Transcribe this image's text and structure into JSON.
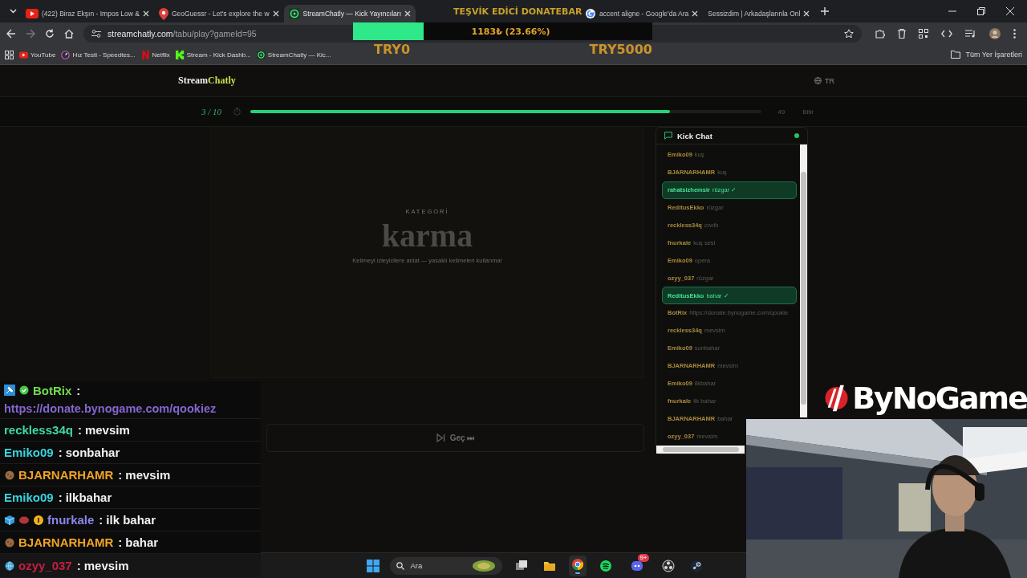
{
  "browser": {
    "tabs": [
      {
        "title": "(422) Biraz Ekşın - Impos Low &",
        "kind": "youtube",
        "selected": false
      },
      {
        "title": "GeoGuessr - Let's explore the w",
        "kind": "pin",
        "selected": false
      },
      {
        "title": "StreamChatly — Kick Yayıncıları",
        "kind": "streamchatly",
        "selected": true
      },
      {
        "title": "accent aligne - Google'da Ara",
        "kind": "google",
        "selected": false
      },
      {
        "title": "Sessizdim | Arkadaşlarınla Onl",
        "kind": "none",
        "selected": false
      }
    ],
    "address": {
      "host": "streamchatly.com",
      "path": "/tabu/play?gameId=95"
    },
    "bookmarks": [
      {
        "label": "YouTube",
        "kind": "youtube"
      },
      {
        "label": "Hız Testi - Speedtes...",
        "kind": "speed"
      },
      {
        "label": "Netflix",
        "kind": "netflix"
      },
      {
        "label": "Stream - Kick Dashb...",
        "kind": "kick"
      },
      {
        "label": "StreamChatly — Kic...",
        "kind": "streamchatly"
      }
    ],
    "all_bookmarks": "Tüm Yer İşaretleri"
  },
  "page": {
    "logo": {
      "first": "Stream",
      "second": "Chatly"
    },
    "language": "TR",
    "progress": {
      "round": "3 / 10",
      "level": 0.82,
      "time": "49",
      "finish": "Bitir"
    },
    "card": {
      "label": "KATEGORİ",
      "word": "karma",
      "hint": "Kelimeyi izleyicilere anlat — yasaklı kelimeleri kullanma!",
      "skip": "Geç ⏭"
    }
  },
  "kick_chat": {
    "title": "Kick Chat",
    "live": true,
    "messages": [
      {
        "user": "Emiko09",
        "text": "kuş",
        "correct": false
      },
      {
        "user": "BJARNARHAMR",
        "text": "kuş",
        "correct": false
      },
      {
        "user": "rahatsizhemsir",
        "text": "rüzgar ✓",
        "correct": true
      },
      {
        "user": "ReditusEkko",
        "text": "rüzgar",
        "correct": false
      },
      {
        "user": "reckless34q",
        "text": "cıvıltı",
        "correct": false
      },
      {
        "user": "fnurkale",
        "text": "kuş sesi",
        "correct": false
      },
      {
        "user": "Emiko09",
        "text": "opera",
        "correct": false
      },
      {
        "user": "ozyy_037",
        "text": "rüzgar",
        "correct": false
      },
      {
        "user": "ReditusEkko",
        "text": "bahar ✓",
        "correct": true
      },
      {
        "user": "BotRix",
        "text": "https://donate.bynogame.com/qookie",
        "correct": false
      },
      {
        "user": "reckless34q",
        "text": "mevsim",
        "correct": false
      },
      {
        "user": "Emiko09",
        "text": "sonbahar",
        "correct": false
      },
      {
        "user": "BJARNARHAMR",
        "text": "mevsim",
        "correct": false
      },
      {
        "user": "Emiko09",
        "text": "ilkbahar",
        "correct": false
      },
      {
        "user": "fnurkale",
        "text": "ilk bahar",
        "correct": false
      },
      {
        "user": "BJARNARHAMR",
        "text": "bahar",
        "correct": false
      },
      {
        "user": "ozyy_037",
        "text": "mevsim",
        "correct": false
      }
    ]
  },
  "donation": {
    "title": "TEŞVİK EDİCİ DONATEBAR",
    "amount": "1183₺ (23.66%)",
    "level": 0.2366,
    "min": "TRY0",
    "max": "TRY5000"
  },
  "overlay_logo": {
    "text": "ByNoGame"
  },
  "overlay_chat": [
    {
      "user": "BotRix",
      "color": "#73dd4e",
      "badges": [
        {
          "kind": "bot"
        },
        {
          "kind": "verified"
        }
      ],
      "sep": ":",
      "text": "https://donate.bynogame.com/qookiez",
      "kind": "link"
    },
    {
      "user": "reckless34q",
      "color": "#3fd8a6",
      "sep": ":",
      "text": "mevsim",
      "kind": "plain"
    },
    {
      "user": "Emiko09",
      "color": "#38d3de",
      "sep": ":",
      "text": "sonbahar",
      "kind": "plain"
    },
    {
      "user": "BJARNARHAMR",
      "color": "#f0a326",
      "badges": [
        {
          "kind": "cookie"
        }
      ],
      "sep": ":",
      "text": "mevsim",
      "kind": "plain"
    },
    {
      "user": "Emiko09",
      "color": "#38d3de",
      "sep": ":",
      "text": "ilkbahar",
      "kind": "plain"
    },
    {
      "user": "fnurkale",
      "color": "#8e86ea",
      "badges": [
        {
          "kind": "cube"
        },
        {
          "kind": "sub"
        },
        {
          "kind": "coin"
        }
      ],
      "sep": ":",
      "text": "ilk bahar",
      "kind": "plain"
    },
    {
      "user": "BJARNARHAMR",
      "color": "#f0a326",
      "badges": [
        {
          "kind": "cookie"
        }
      ],
      "sep": ":",
      "text": "bahar",
      "kind": "plain"
    },
    {
      "user": "ozyy_037",
      "color": "#c42040",
      "badges": [
        {
          "kind": "globe"
        }
      ],
      "sep": ":",
      "text": "mevsim",
      "kind": "plain"
    }
  ],
  "taskbar": {
    "search": "Ara",
    "apps": [
      {
        "kind": "files-stack",
        "active": false
      },
      {
        "kind": "folder",
        "active": false
      },
      {
        "kind": "chrome",
        "active": true
      },
      {
        "kind": "spotify",
        "active": false
      },
      {
        "kind": "discord",
        "active": false,
        "badge": "9+"
      },
      {
        "kind": "obs",
        "active": false
      },
      {
        "kind": "steam",
        "active": false
      }
    ]
  }
}
